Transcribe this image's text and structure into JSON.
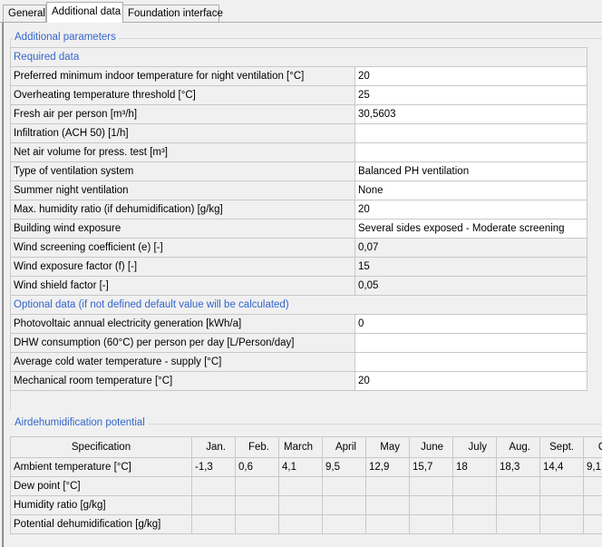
{
  "tabs": [
    {
      "label": "General",
      "selected": false
    },
    {
      "label": "Additional data",
      "selected": true
    },
    {
      "label": "Foundation interface",
      "selected": false
    }
  ],
  "additional_parameters": {
    "legend": "Additional parameters",
    "required_header": "Required data",
    "required_rows": [
      {
        "label": "Preferred minimum indoor temperature for night ventilation  [°C]",
        "value": "20",
        "readonly": false
      },
      {
        "label": "Overheating temperature threshold  [°C]",
        "value": "25",
        "readonly": false
      },
      {
        "label": "Fresh air per person  [m³/h]",
        "value": "30,5603",
        "readonly": false
      },
      {
        "label": "Infiltration (ACH 50)  [1/h]",
        "value": "",
        "readonly": false
      },
      {
        "label": "Net air volume for press. test  [m³]",
        "value": "",
        "readonly": false
      },
      {
        "label": "Type of ventilation system",
        "value": "Balanced PH ventilation",
        "readonly": false
      },
      {
        "label": "Summer night ventilation",
        "value": "None",
        "readonly": false
      },
      {
        "label": "Max. humidity ratio (if dehumidification)  [g/kg]",
        "value": "20",
        "readonly": false
      },
      {
        "label": "Building wind exposure",
        "value": "Several sides exposed - Moderate screening",
        "readonly": false
      },
      {
        "label": "Wind screening coefficient (e)  [-]",
        "value": "0,07",
        "readonly": true
      },
      {
        "label": "Wind exposure factor (f)  [-]",
        "value": "15",
        "readonly": true
      },
      {
        "label": "Wind shield factor  [-]",
        "value": "0,05",
        "readonly": true
      }
    ],
    "optional_header": "Optional data (if not defined default value will be calculated)",
    "optional_rows": [
      {
        "label": "Photovoltaic annual electricity generation  [kWh/a]",
        "value": "0",
        "readonly": false
      },
      {
        "label": "DHW consumption (60°C) per person per day [L/Person/day]",
        "value": "",
        "readonly": false
      },
      {
        "label": "Average cold water temperature - supply  [°C]",
        "value": "",
        "readonly": false
      },
      {
        "label": "Mechanical room temperature  [°C]",
        "value": "20",
        "readonly": false
      }
    ]
  },
  "dehumidification": {
    "legend": "Airdehumidification potential",
    "spec_header": "Specification",
    "months": [
      "Jan.",
      "Feb.",
      "March",
      "April",
      "May",
      "June",
      "July",
      "Aug.",
      "Sept.",
      "Oct."
    ],
    "rows": [
      {
        "label": "Ambient temperature [°C]",
        "values": [
          "-1,3",
          "0,6",
          "4,1",
          "9,5",
          "12,9",
          "15,7",
          "18",
          "18,3",
          "14,4",
          "9,1"
        ]
      },
      {
        "label": "Dew point [°C]",
        "values": [
          "",
          "",
          "",
          "",
          "",
          "",
          "",
          "",
          "",
          ""
        ]
      },
      {
        "label": "Humidity ratio [g/kg]",
        "values": [
          "",
          "",
          "",
          "",
          "",
          "",
          "",
          "",
          "",
          ""
        ]
      },
      {
        "label": "Potential dehumidification [g/kg]",
        "values": [
          "",
          "",
          "",
          "",
          "",
          "",
          "",
          "",
          "",
          ""
        ]
      }
    ]
  },
  "colors": {
    "section_text": "#3366cc",
    "panel_bg": "#f0f0f0",
    "editable_bg": "#ffffff"
  }
}
